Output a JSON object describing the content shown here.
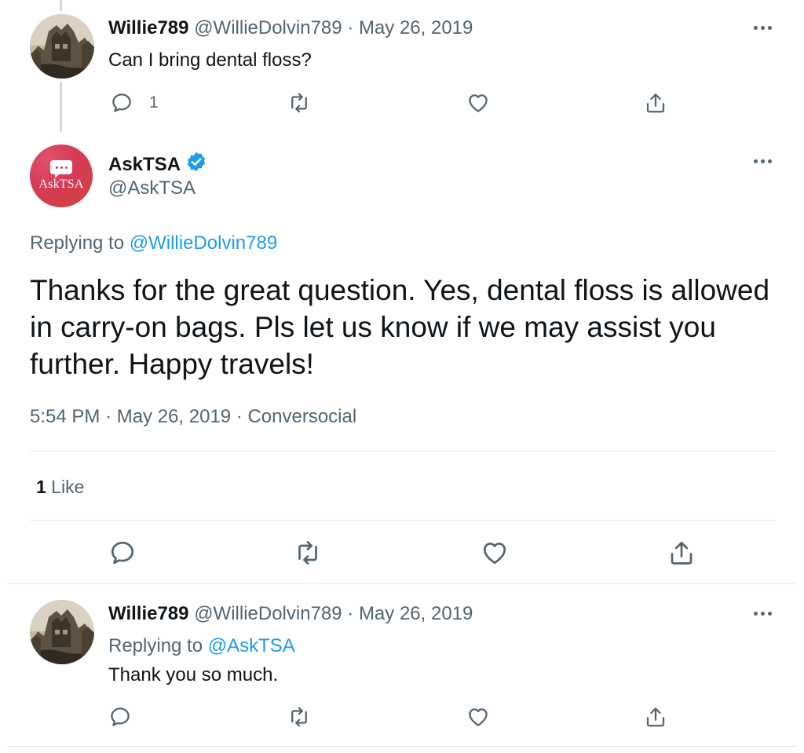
{
  "tweet1": {
    "name": "Willie789",
    "meta": "@WillieDolvin789 · May 26, 2019",
    "text": "Can I bring dental floss?",
    "reply_count": "1"
  },
  "tweet2": {
    "name": "AskTSA",
    "handle": "@AskTSA",
    "avatar_text": "AskTSA",
    "verified": true,
    "replying_label": "Replying to ",
    "replying_handle": "@WillieDolvin789",
    "text": "Thanks for the great question. Yes, dental floss is allowed in carry-on bags. Pls let us know if we may assist you further. Happy travels!",
    "timestamp": "5:54 PM · May 26, 2019 · Conversocial",
    "like_count": "1",
    "like_label": " Like"
  },
  "tweet3": {
    "name": "Willie789",
    "meta": "@WillieDolvin789 · May 26, 2019",
    "replying_label": "Replying to ",
    "replying_handle": "@AskTSA",
    "text": "Thank you so much."
  },
  "icons": {
    "reply": "reply-icon",
    "retweet": "retweet-icon",
    "like": "heart-icon",
    "share": "share-icon",
    "more": "more-icon",
    "verified": "verified-badge-icon"
  },
  "colors": {
    "link": "#1d9bf0",
    "secondary_text": "#536471",
    "verified": "#1d9bf0",
    "tsa_avatar": "#d63a55"
  }
}
